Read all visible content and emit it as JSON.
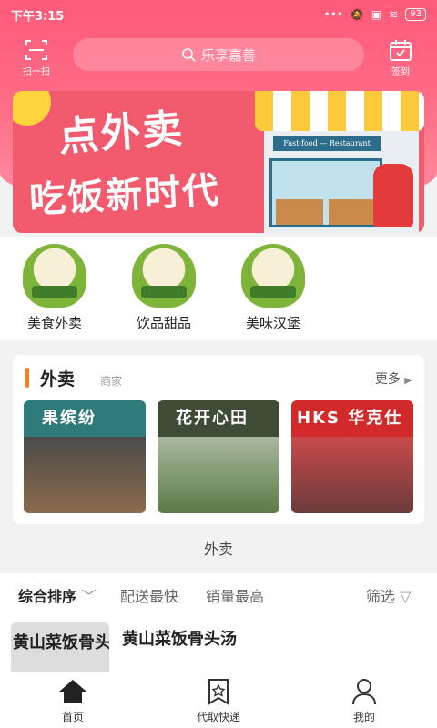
{
  "status_bar": {
    "time": "下午3:15",
    "battery": "93"
  },
  "header": {
    "scan_label": "扫一扫",
    "search_placeholder": "乐享嘉善",
    "sign_label": "签到"
  },
  "banner": {
    "line1": "点外卖",
    "line2": "吃饭新时代",
    "shop_sign": "Fast-food — Restaurant",
    "colors": {
      "background": "#f15b6d",
      "awning": "#ffc93c",
      "sign": "#2d6d8c"
    }
  },
  "categories": [
    {
      "label": "美食外卖",
      "icon": "zongzi-icon"
    },
    {
      "label": "饮品甜品",
      "icon": "zongzi-drink-icon"
    },
    {
      "label": "美味汉堡",
      "icon": "zongzi-star-icon"
    }
  ],
  "takeout_section": {
    "title": "外卖",
    "subtitle": "商家",
    "more": "更多",
    "shops": [
      {
        "sign": "果缤纷",
        "sign_color": "#2f7a7a"
      },
      {
        "sign": "花开心田",
        "sign_color": "#3d4b37"
      },
      {
        "sign": "HKS 华克仕",
        "sign_color": "#d22a2a"
      }
    ]
  },
  "divider_label": "外卖",
  "sort": {
    "items": [
      "综合排序",
      "配送最快",
      "销量最高"
    ],
    "filter": "筛选"
  },
  "list": [
    {
      "thumb_text": "黄山菜饭骨头",
      "name": "黄山菜饭骨头汤"
    }
  ],
  "tabbar": {
    "items": [
      "首页",
      "代取快递",
      "我的"
    ]
  },
  "colors": {
    "primary": "#ff5a7a",
    "accent": "#ff7a1a"
  }
}
